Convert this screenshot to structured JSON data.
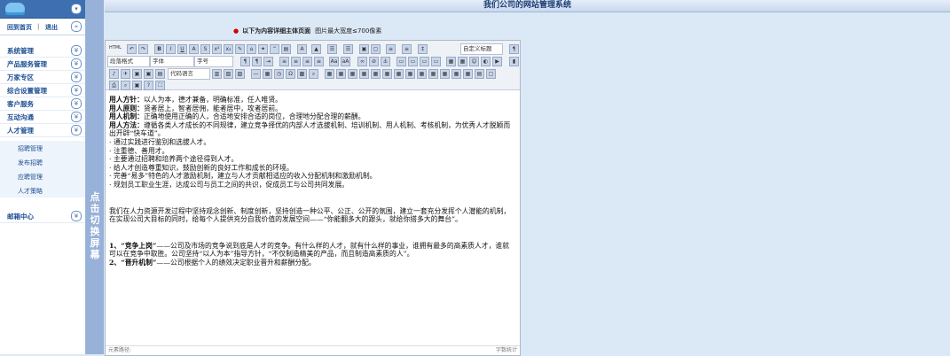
{
  "sidebar": {
    "links": {
      "home": "回到首页",
      "sep": "|",
      "logout": "退出"
    },
    "menu": [
      {
        "label": "系统管理"
      },
      {
        "label": "产品服务管理"
      },
      {
        "label": "万家专区"
      },
      {
        "label": "综合设置管理"
      },
      {
        "label": "客户服务"
      },
      {
        "label": "互动沟通"
      },
      {
        "label": "人才管理"
      }
    ],
    "submenu": [
      "招聘管理",
      "发布招聘",
      "应聘管理",
      "人才策略"
    ],
    "mail": "邮箱中心"
  },
  "toggle": {
    "text": "点击切换屏幕"
  },
  "header": {
    "title": "我们公司的网站管理系统"
  },
  "notice": {
    "bold": "以下为内容详细主体页面",
    "rest": "图片最大宽度≤700像素"
  },
  "toolbar": {
    "format_select": "段落格式",
    "font_select": "字体",
    "size_select": "字号",
    "code_select": "代码语言",
    "title_select": "自定义标题",
    "source": "HTML"
  },
  "content": {
    "p1_label": "用人方针：",
    "p1_text": "以人为本，德才兼备，明确标准，任人唯贤。",
    "p2_label": "用人原则：",
    "p2_text": "贤者居上，智者居佣，能者居中，攻者居前。",
    "p3_label": "用人机制：",
    "p3_text": "正确地使用正确的人，合适地安排合适的岗位，合理地分配合理的薪酬。",
    "p4_label": "用人方法：",
    "p4_text": "遵循各类人才成长的不同规律，建立竞争择优的内部人才选拔机制、培训机制、用人机制、考核机制，为优秀人才脱颖而出开辟“快车道”。",
    "bullets": [
      "· 通过实践进行鉴别和选拔人才。",
      "· 注重德、善用才。",
      "· 主要通过招聘和培养两个途径得到人才。",
      "· 给人才创造尊重知识，鼓励创新的良好工作和成长的环境。",
      "· 完善“易多”特色的人才激励机制，建立与人才贡献相适应的收入分配机制和激励机制。",
      "· 规划员工职业生涯，达成公司与员工之间的共识，促成员工与公司共同发展。"
    ],
    "para": "我们在人力资源开发过程中坚持观念创新、制度创新，坚持创造一种公平、公正、公开的氛围，建立一套充分发挥个人潜能的机制，在实现公司大目标的同时，给每个人提供充分自我价值的发展空间——“你能翻多大的跟头，就给你搭多大的舞台”。",
    "item1_label": "1、“竞争上岗”",
    "item1_text": "——公司及市场的竞争说到底是人才的竞争。有什么样的人才，就有什么样的事业，谁拥有最多的高素质人才，谁就可以在竞争中取胜。公司坚持“以人为本”指导方针，“不仅制造精美的产品，而且制造高素质的人”。",
    "item2_label": "2、“晋升机制”",
    "item2_text": "——公司根据个人的绩效决定职业晋升和薪酬分配。"
  },
  "status": {
    "left": "元素路径:",
    "right": "字数统计"
  },
  "colors": {
    "sidebar_header": "#3d6fb1",
    "toggle": "#97b1d8",
    "background": "#dbe9f7"
  }
}
